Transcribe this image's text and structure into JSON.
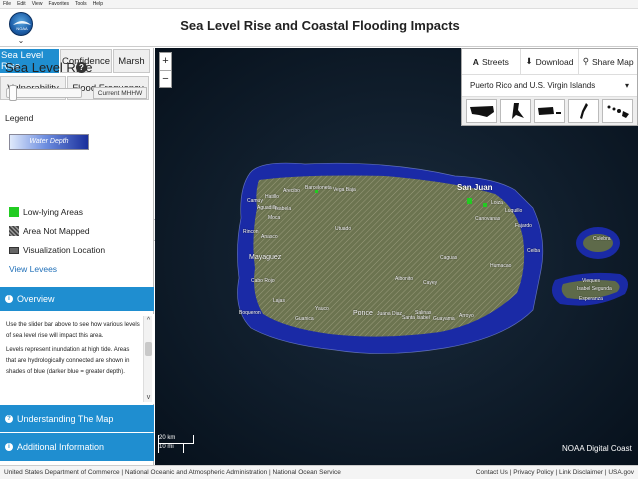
{
  "menubar": {
    "items": [
      "File",
      "Edit",
      "View",
      "Favorites",
      "Tools",
      "Help"
    ]
  },
  "header": {
    "title": "Sea Level Rise and Coastal Flooding Impacts",
    "logo_text": "NOAA"
  },
  "tabs": {
    "row1": [
      "Sea Level Rise",
      "Confidence",
      "Marsh"
    ],
    "row2": [
      "Vulnerability",
      "Flood Frequency"
    ],
    "active": "Sea Level Rise"
  },
  "slr_panel": {
    "heading": "Sea Level Rise",
    "current_button": "Current MHHW",
    "slider_value_fraction": 0.0
  },
  "legend": {
    "title": "Legend",
    "water_depth_label": "Water Depth",
    "items": [
      {
        "label": "Low-lying Areas",
        "icon": "green-swatch"
      },
      {
        "label": "Area Not Mapped",
        "icon": "hatch-swatch"
      },
      {
        "label": "Visualization Location",
        "icon": "location-swatch"
      }
    ],
    "levees_link": "View Levees"
  },
  "panels": {
    "overview": "Overview",
    "overview_text": [
      "Use the slider bar above to see how various levels of sea level rise will impact this area.",
      "Levels represent inundation at high tide. Areas that are hydrologically connected are shown in shades of blue (darker blue = greater depth)."
    ],
    "understanding": "Understanding The Map",
    "additional": "Additional Information"
  },
  "map": {
    "zoom_in": "+",
    "zoom_out": "−",
    "scale_km": "20 km",
    "scale_mi": "10 mi",
    "attribution": "NOAA Digital Coast",
    "labels": [
      "San Juan",
      "Vega Baja",
      "Barceloneta",
      "Arecibo",
      "Hatillo",
      "Camuy",
      "Aguadilla",
      "Isabela",
      "Moca",
      "Rincon",
      "Anasco",
      "Mayaguez",
      "Cabo Rojo",
      "Lajas",
      "Guanica",
      "Yauco",
      "Ponce",
      "Juana Diaz",
      "Santa Isabel",
      "Salinas",
      "Guayama",
      "Arroyo",
      "Humacao",
      "Fajardo",
      "Luquillo",
      "Canovanas",
      "Caguas",
      "Cayey",
      "Utuado",
      "Culebra",
      "Vieques",
      "Isabel Segunda",
      "Esperanza",
      "Boqueron",
      "Ceiba",
      "Loiza",
      "Aibonito"
    ]
  },
  "tools": {
    "streets": "Streets",
    "download": "Download",
    "share": "Share Map",
    "region_selected": "Puerto Rico and U.S. Virgin Islands",
    "region_thumbnails": [
      "us-map-icon",
      "alaska-map-icon",
      "puerto-rico-map-icon",
      "guam-map-icon",
      "hawaii-map-icon"
    ]
  },
  "footer": {
    "left": "United States Department of Commerce | National Oceanic and Atmospheric Administration | National Ocean Service",
    "right": "Contact Us | Privacy Policy | Link Disclaimer | USA.gov"
  },
  "colors": {
    "accent": "#1f8ed0",
    "low_lying": "#22cc22",
    "water_shallow": "#dfe9fb",
    "water_deep": "#1a2f9c"
  }
}
